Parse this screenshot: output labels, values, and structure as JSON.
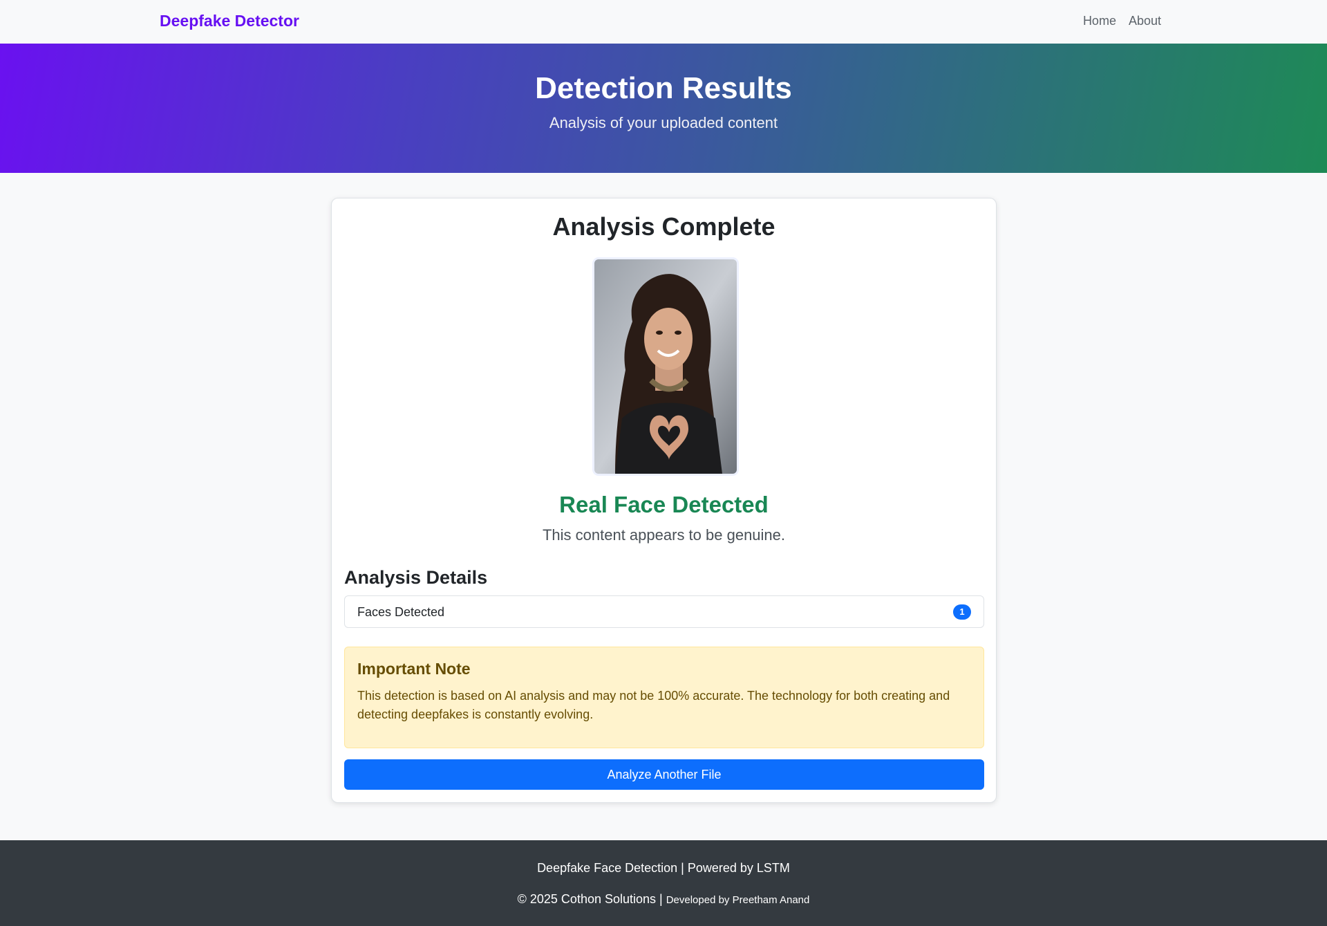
{
  "navbar": {
    "brand": "Deepfake Detector",
    "links": [
      "Home",
      "About"
    ]
  },
  "hero": {
    "title": "Detection Results",
    "subtitle": "Analysis of your uploaded content"
  },
  "card": {
    "title": "Analysis Complete",
    "result_title": "Real Face Detected",
    "result_text": "This content appears to be genuine.",
    "details_heading": "Analysis Details",
    "details": [
      {
        "label": "Faces Detected",
        "value": "1"
      }
    ],
    "note_title": "Important Note",
    "note_text": "This detection is based on AI analysis and may not be 100% accurate. The technology for both creating and detecting deepfakes is constantly evolving.",
    "button_label": "Analyze Another File"
  },
  "footer": {
    "line1": "Deepfake Face Detection | Powered by LSTM",
    "copyright": "© 2025 Cothon Solutions | ",
    "developer": "Developed by Preetham Anand"
  },
  "colors": {
    "brand": "#6610f2",
    "success": "#198754",
    "primary": "#0d6efd",
    "footer_bg": "#343a40"
  }
}
